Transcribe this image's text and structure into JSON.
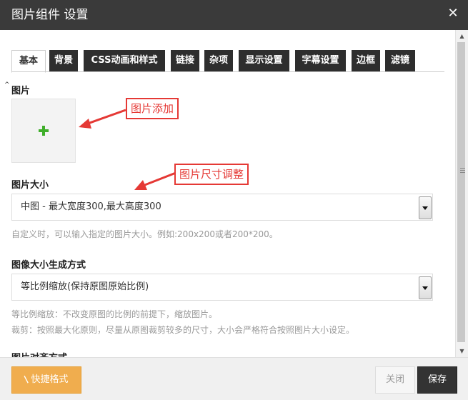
{
  "dialog": {
    "title": "图片组件 设置",
    "close_label": "✕"
  },
  "tabs": [
    {
      "label": "基本",
      "active": true
    },
    {
      "label": "背景"
    },
    {
      "label": "CSS动画和样式"
    },
    {
      "label": "链接"
    },
    {
      "label": "杂项"
    },
    {
      "label": "显示设置"
    },
    {
      "label": "字幕设置"
    },
    {
      "label": "边框"
    },
    {
      "label": "滤镜"
    }
  ],
  "image_section": {
    "title": "图片",
    "collapse_glyph": "^",
    "add_icon": "plus-icon"
  },
  "size_section": {
    "title": "图片大小",
    "selected": "中图 - 最大宽度300,最大高度300",
    "help": "自定义时，可以输入指定的图片大小。例如:200x200或者200*200。"
  },
  "generate_section": {
    "title": "图像大小生成方式",
    "selected": "等比例缩放(保持原图原始比例)",
    "help_1": "等比例缩放：不改变原图的比例的前提下，缩放图片。",
    "help_2": "裁剪：按照最大化原则，尽量从原图裁剪较多的尺寸，大小会严格符合按照图片大小设定。"
  },
  "align_section": {
    "title": "图片对齐方式"
  },
  "annotations": {
    "add_image": "图片添加",
    "resize_image": "图片尺寸调整",
    "color": "#e53935"
  },
  "footer": {
    "quick_format": "快捷格式",
    "close": "关闭",
    "save": "保存"
  },
  "colors": {
    "titlebar": "#3a3a3a",
    "tab_dark": "#2e2e2e",
    "quick_button": "#f0ad4e",
    "save_button": "#333333",
    "plus_icon": "#3fae2a"
  }
}
